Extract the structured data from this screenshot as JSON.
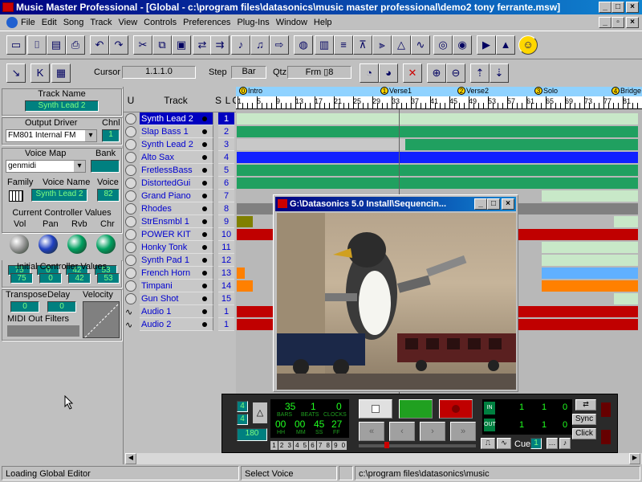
{
  "window": {
    "title": "Music Master Professional - [Global - c:\\program files\\datasonics\\music master professional\\demo2 tony ferrante.msw]"
  },
  "menu": [
    "File",
    "Edit",
    "Song",
    "Track",
    "View",
    "Controls",
    "Preferences",
    "Plug-Ins",
    "Window",
    "Help"
  ],
  "toolbar2": {
    "cursor_label": "Cursor",
    "cursor_value": "1.1.1.0",
    "step_label": "Step",
    "step_value": "Bar",
    "qtz_label": "Qtz",
    "qtz_value": "Frm ▯8"
  },
  "left": {
    "track_name_label": "Track Name",
    "track_name": "Synth Lead 2",
    "output_driver_label": "Output Driver",
    "chnl_label": "Chnl",
    "output_driver": "FM801 Internal FM",
    "chnl": "1",
    "voice_map_label": "Voice Map",
    "bank_label": "Bank",
    "voice_map": "genmidi",
    "family_label": "Family",
    "voice_name_label": "Voice Name",
    "voice_label": "Voice",
    "voice_name": "Synth Lead 2",
    "voice": "82",
    "ccv_label": "Current Controller Values",
    "ccv_heads": [
      "Vol",
      "Pan",
      "Rvb",
      "Chr"
    ],
    "ccv_vals": [
      "75",
      "0",
      "42",
      "53"
    ],
    "icv_label": "Initial Controller Values",
    "icv_vals": [
      "75",
      "0",
      "42",
      "53"
    ],
    "transpose_label": "Transpose",
    "delay_label": "Delay",
    "velocity_label": "Velocity",
    "transpose": "0",
    "delay": "0",
    "midi_filters_label": "MIDI Out Filters"
  },
  "tracklist": {
    "headers": [
      "U",
      "Track",
      "S",
      "L",
      "Ch"
    ],
    "tracks": [
      {
        "name": "Synth Lead 2",
        "ch": "1",
        "selected": true
      },
      {
        "name": "Slap Bass 1",
        "ch": "2"
      },
      {
        "name": "Synth Lead 2",
        "ch": "3"
      },
      {
        "name": "Alto Sax",
        "ch": "4"
      },
      {
        "name": "FretlessBass",
        "ch": "5"
      },
      {
        "name": "DistortedGui",
        "ch": "6"
      },
      {
        "name": "Grand Piano",
        "ch": "7"
      },
      {
        "name": "Rhodes",
        "ch": "8"
      },
      {
        "name": "StrEnsmbl 1",
        "ch": "9"
      },
      {
        "name": "POWER KIT",
        "ch": "10"
      },
      {
        "name": "Honky Tonk",
        "ch": "11"
      },
      {
        "name": "Synth Pad 1",
        "ch": "12"
      },
      {
        "name": "French Horn",
        "ch": "13"
      },
      {
        "name": "Timpani",
        "ch": "14"
      },
      {
        "name": "Gun Shot",
        "ch": "15"
      },
      {
        "name": "Audio 1",
        "ch": "1",
        "audio": true
      },
      {
        "name": "Audio 2",
        "ch": "1",
        "audio": true
      }
    ]
  },
  "ruler": {
    "markers": [
      {
        "n": "0",
        "label": "Intro"
      },
      {
        "n": "1",
        "label": "Verse1"
      },
      {
        "n": "2",
        "label": "Verse2"
      },
      {
        "n": "3",
        "label": "Solo"
      },
      {
        "n": "4",
        "label": "Bridge"
      }
    ],
    "ticks": [
      "1",
      "5",
      "9",
      "13",
      "17",
      "21",
      "25",
      "29",
      "33",
      "37",
      "41",
      "45",
      "49",
      "53",
      "57",
      "61",
      "65",
      "69",
      "73",
      "77",
      "81"
    ]
  },
  "video": {
    "title": "G:\\Datasonics 5.0 Install\\Sequencin..."
  },
  "transport": {
    "sig_top": "4",
    "sig_bot": "4",
    "tempo": "180",
    "bars": "35",
    "beats": "1",
    "clocks": "0",
    "bars_lbl": "BARS",
    "beats_lbl": "BEATS",
    "clocks_lbl": "CLOCKS",
    "hh": "00",
    "mm": "00",
    "ss": "45",
    "ff": "27",
    "hh_lbl": "HH",
    "mm_lbl": "MM",
    "ss_lbl": "SS",
    "ff_lbl": "FF",
    "in1": "1",
    "in2": "1",
    "in3": "0",
    "out1": "1",
    "out2": "1",
    "out3": "0",
    "in_lbl": "IN",
    "out_lbl": "OUT",
    "sync": "Sync",
    "click": "Click",
    "cue_label": "Cue",
    "cue": "1",
    "numbers": [
      "1",
      "2",
      "3",
      "4",
      "5",
      "6",
      "7",
      "8",
      "9",
      "0"
    ]
  },
  "status": {
    "left": "Loading Global Editor",
    "middle": "Select Voice",
    "right": "c:\\program files\\datasonics\\music"
  }
}
